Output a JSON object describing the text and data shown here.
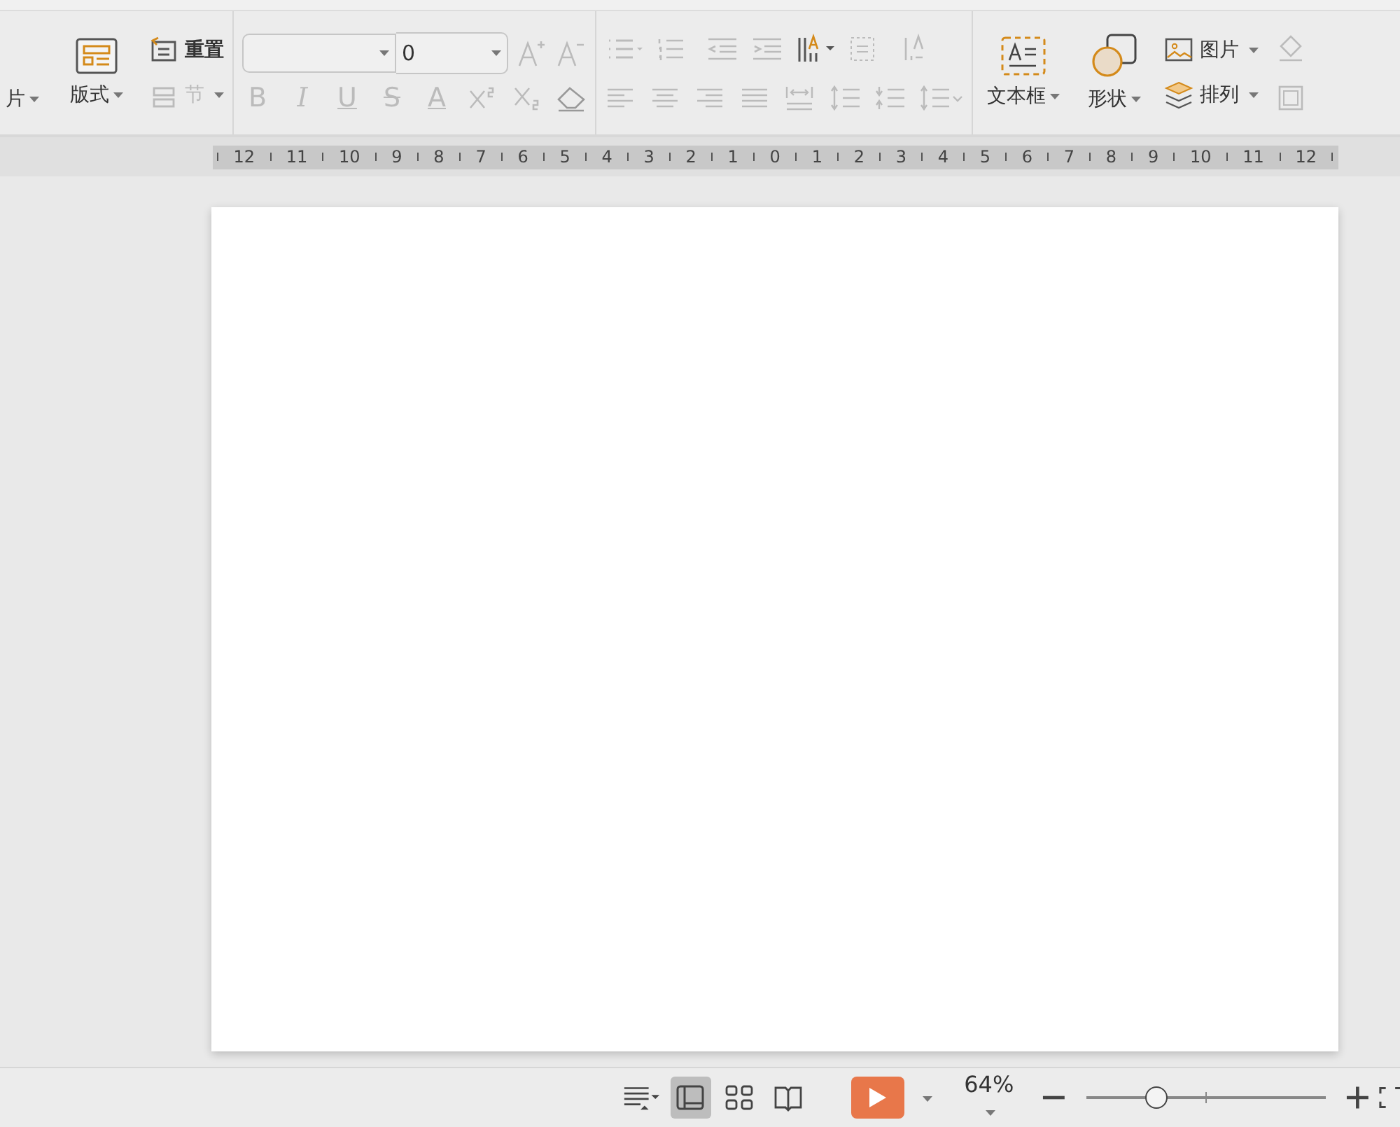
{
  "ribbon": {
    "slide_label": "片",
    "layout_label": "版式",
    "reset_label": "重置",
    "section": {
      "label": "节",
      "disabled": true
    },
    "font": {
      "size": "0"
    },
    "format_buttons": [
      {
        "kind": "bold",
        "label": "B"
      },
      {
        "kind": "italic",
        "label": "I"
      },
      {
        "kind": "underline",
        "label": "U"
      },
      {
        "kind": "strike",
        "label": "S"
      },
      {
        "kind": "color",
        "label": "A"
      }
    ],
    "format_disabled": true,
    "textbox_label": "文本框",
    "shape_label": "形状",
    "picture_label": "图片",
    "arrange_label": "排列"
  },
  "ruler": [
    "12",
    "11",
    "10",
    "9",
    "8",
    "7",
    "6",
    "5",
    "4",
    "3",
    "2",
    "1",
    "0",
    "1",
    "2",
    "3",
    "4",
    "5",
    "6",
    "7",
    "8",
    "9",
    "10",
    "11",
    "12"
  ],
  "status_bar": {
    "views": [
      {
        "kind": "normal",
        "selected": true
      },
      {
        "kind": "sorter",
        "selected": false
      },
      {
        "kind": "reading",
        "selected": false
      }
    ],
    "zoom": "64%",
    "zoom_slider": {
      "level": 0.28
    }
  }
}
